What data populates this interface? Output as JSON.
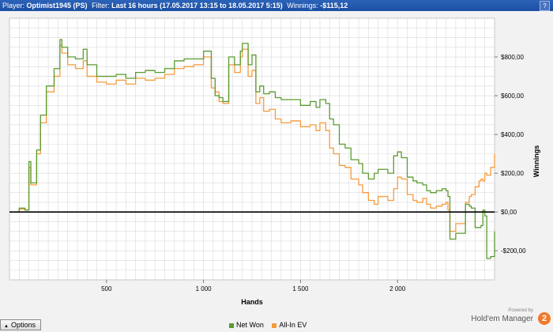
{
  "header": {
    "player_label": "Player:",
    "player_value": "Optimist1945 (PS)",
    "filter_label": "Filter:",
    "filter_value": "Last 16 hours (17.05.2017 13:15 to 18.05.2017 5:15)",
    "winnings_label": "Winnings:",
    "winnings_value": "-$115,12",
    "help_label": "?"
  },
  "footer": {
    "options_label": "Options",
    "powered_by": "Powered by",
    "brand_name": "Hold'em Manager",
    "brand_badge": "2"
  },
  "colors": {
    "net_won": "#5b9a2e",
    "allin_ev": "#f59a3c",
    "zero_line": "#000000",
    "grid": "#d9d9d9"
  },
  "chart_data": {
    "type": "line",
    "xlabel": "Hands",
    "ylabel": "Winnings",
    "xlim": [
      0,
      2500
    ],
    "ylim": [
      -350,
      1000
    ],
    "x_ticks": [
      500,
      1000,
      1500,
      2000
    ],
    "x_tick_labels": [
      "500",
      "1 000",
      "1 500",
      "2 000"
    ],
    "y_ticks": [
      -200,
      0,
      200,
      400,
      600,
      800
    ],
    "y_tick_labels": [
      "-$200,00",
      "$0,00",
      "$200,00",
      "$400,00",
      "$600,00",
      "$800,00"
    ],
    "grid": true,
    "legend_position": "bottom",
    "series": [
      {
        "name": "Net Won",
        "x": [
          0,
          50,
          80,
          100,
          110,
          140,
          160,
          190,
          230,
          260,
          270,
          300,
          340,
          380,
          400,
          450,
          500,
          550,
          600,
          650,
          700,
          750,
          800,
          850,
          900,
          950,
          1000,
          1040,
          1060,
          1080,
          1100,
          1130,
          1160,
          1190,
          1200,
          1230,
          1250,
          1270,
          1290,
          1310,
          1340,
          1370,
          1400,
          1450,
          1500,
          1550,
          1580,
          1600,
          1630,
          1650,
          1670,
          1700,
          1730,
          1760,
          1800,
          1820,
          1850,
          1880,
          1900,
          1950,
          1980,
          2000,
          2020,
          2050,
          2080,
          2100,
          2130,
          2150,
          2170,
          2200,
          2230,
          2250,
          2260,
          2270,
          2300,
          2350,
          2370,
          2380,
          2400,
          2420,
          2430,
          2440,
          2450,
          2460,
          2480,
          2500
        ],
        "y": [
          0,
          20,
          10,
          260,
          150,
          320,
          500,
          650,
          740,
          890,
          850,
          800,
          790,
          840,
          760,
          700,
          700,
          710,
          690,
          720,
          730,
          720,
          740,
          780,
          790,
          790,
          830,
          690,
          600,
          590,
          570,
          800,
          760,
          830,
          870,
          760,
          810,
          620,
          650,
          610,
          620,
          590,
          580,
          580,
          550,
          570,
          540,
          580,
          560,
          480,
          450,
          350,
          330,
          270,
          250,
          200,
          170,
          200,
          220,
          200,
          290,
          310,
          280,
          180,
          160,
          150,
          140,
          110,
          100,
          110,
          120,
          110,
          80,
          -140,
          -110,
          40,
          30,
          20,
          -80,
          -80,
          -70,
          10,
          -20,
          -240,
          -230,
          -100
        ]
      },
      {
        "name": "All-In EV",
        "x": [
          0,
          50,
          80,
          100,
          110,
          140,
          160,
          190,
          230,
          260,
          270,
          300,
          340,
          380,
          400,
          450,
          500,
          550,
          600,
          650,
          700,
          750,
          800,
          850,
          900,
          950,
          1000,
          1040,
          1060,
          1080,
          1100,
          1130,
          1160,
          1190,
          1200,
          1230,
          1250,
          1270,
          1290,
          1310,
          1340,
          1370,
          1400,
          1450,
          1500,
          1550,
          1580,
          1600,
          1630,
          1650,
          1670,
          1700,
          1730,
          1760,
          1800,
          1820,
          1850,
          1880,
          1900,
          1950,
          1980,
          2000,
          2020,
          2050,
          2080,
          2100,
          2130,
          2150,
          2170,
          2200,
          2230,
          2250,
          2260,
          2270,
          2300,
          2350,
          2370,
          2380,
          2400,
          2420,
          2430,
          2440,
          2450,
          2460,
          2480,
          2500
        ],
        "y": [
          0,
          15,
          10,
          230,
          140,
          300,
          460,
          620,
          700,
          860,
          820,
          760,
          740,
          780,
          700,
          670,
          660,
          680,
          660,
          690,
          680,
          690,
          710,
          740,
          750,
          760,
          800,
          640,
          620,
          570,
          560,
          760,
          720,
          800,
          840,
          700,
          730,
          560,
          590,
          520,
          530,
          480,
          460,
          470,
          440,
          450,
          420,
          460,
          420,
          330,
          300,
          240,
          230,
          170,
          140,
          100,
          60,
          40,
          80,
          60,
          120,
          180,
          170,
          90,
          60,
          50,
          70,
          40,
          20,
          30,
          40,
          50,
          10,
          -100,
          -60,
          50,
          80,
          90,
          130,
          160,
          170,
          160,
          200,
          190,
          230,
          300
        ]
      }
    ]
  }
}
